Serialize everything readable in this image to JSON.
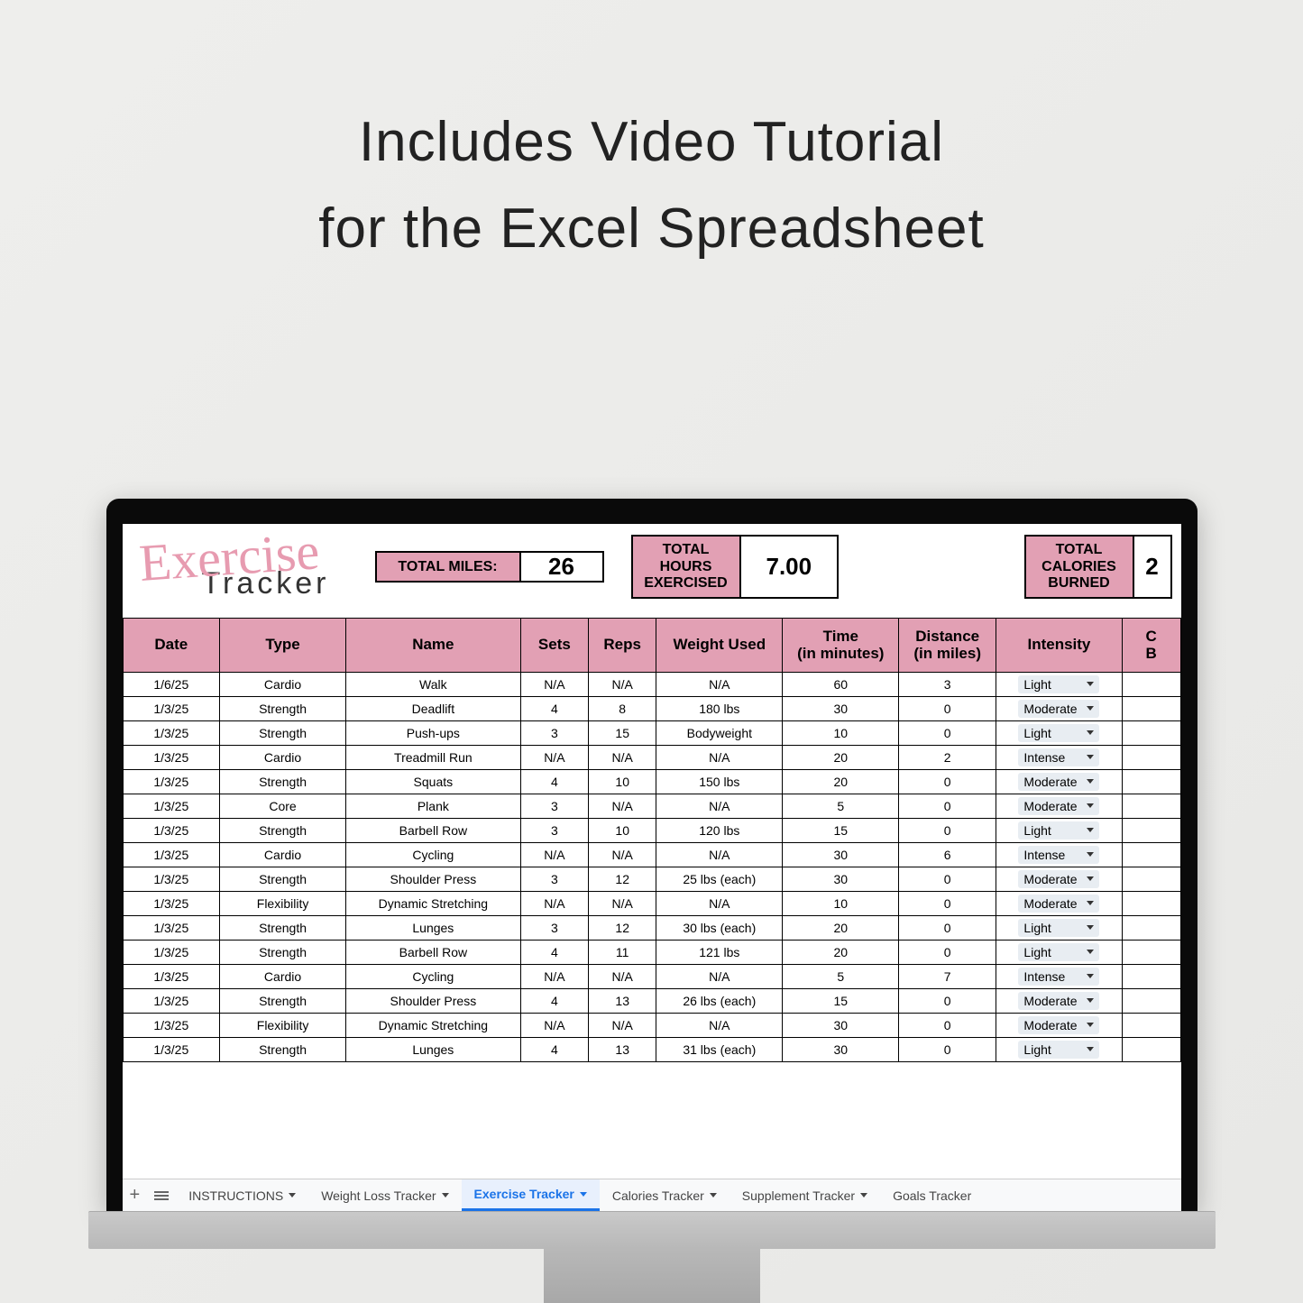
{
  "headline": {
    "line1": "Includes Video Tutorial",
    "line2": "for the Excel Spreadsheet"
  },
  "logo": {
    "script": "Exercise",
    "sub": "Tracker"
  },
  "summary": {
    "miles_label": "TOTAL MILES:",
    "miles_value": "26",
    "hours_label": "TOTAL\nHOURS\nEXERCISED",
    "hours_value": "7.00",
    "cals_label": "TOTAL\nCALORIES\nBURNED",
    "cals_value": "2"
  },
  "columns": {
    "date": "Date",
    "type": "Type",
    "name": "Name",
    "sets": "Sets",
    "reps": "Reps",
    "weight": "Weight Used",
    "time": "Time\n(in minutes)",
    "dist": "Distance\n(in miles)",
    "intensity": "Intensity",
    "cals": "C\nB"
  },
  "rows": [
    {
      "date": "1/6/25",
      "type": "Cardio",
      "name": "Walk",
      "sets": "N/A",
      "reps": "N/A",
      "weight": "N/A",
      "time": "60",
      "dist": "3",
      "intensity": "Light"
    },
    {
      "date": "1/3/25",
      "type": "Strength",
      "name": "Deadlift",
      "sets": "4",
      "reps": "8",
      "weight": "180 lbs",
      "time": "30",
      "dist": "0",
      "intensity": "Moderate"
    },
    {
      "date": "1/3/25",
      "type": "Strength",
      "name": "Push-ups",
      "sets": "3",
      "reps": "15",
      "weight": "Bodyweight",
      "time": "10",
      "dist": "0",
      "intensity": "Light"
    },
    {
      "date": "1/3/25",
      "type": "Cardio",
      "name": "Treadmill Run",
      "sets": "N/A",
      "reps": "N/A",
      "weight": "N/A",
      "time": "20",
      "dist": "2",
      "intensity": "Intense"
    },
    {
      "date": "1/3/25",
      "type": "Strength",
      "name": "Squats",
      "sets": "4",
      "reps": "10",
      "weight": "150 lbs",
      "time": "20",
      "dist": "0",
      "intensity": "Moderate"
    },
    {
      "date": "1/3/25",
      "type": "Core",
      "name": "Plank",
      "sets": "3",
      "reps": "N/A",
      "weight": "N/A",
      "time": "5",
      "dist": "0",
      "intensity": "Moderate"
    },
    {
      "date": "1/3/25",
      "type": "Strength",
      "name": "Barbell Row",
      "sets": "3",
      "reps": "10",
      "weight": "120 lbs",
      "time": "15",
      "dist": "0",
      "intensity": "Light"
    },
    {
      "date": "1/3/25",
      "type": "Cardio",
      "name": "Cycling",
      "sets": "N/A",
      "reps": "N/A",
      "weight": "N/A",
      "time": "30",
      "dist": "6",
      "intensity": "Intense"
    },
    {
      "date": "1/3/25",
      "type": "Strength",
      "name": "Shoulder Press",
      "sets": "3",
      "reps": "12",
      "weight": "25 lbs (each)",
      "time": "30",
      "dist": "0",
      "intensity": "Moderate"
    },
    {
      "date": "1/3/25",
      "type": "Flexibility",
      "name": "Dynamic Stretching",
      "sets": "N/A",
      "reps": "N/A",
      "weight": "N/A",
      "time": "10",
      "dist": "0",
      "intensity": "Moderate"
    },
    {
      "date": "1/3/25",
      "type": "Strength",
      "name": "Lunges",
      "sets": "3",
      "reps": "12",
      "weight": "30 lbs (each)",
      "time": "20",
      "dist": "0",
      "intensity": "Light"
    },
    {
      "date": "1/3/25",
      "type": "Strength",
      "name": "Barbell Row",
      "sets": "4",
      "reps": "11",
      "weight": "121 lbs",
      "time": "20",
      "dist": "0",
      "intensity": "Light"
    },
    {
      "date": "1/3/25",
      "type": "Cardio",
      "name": "Cycling",
      "sets": "N/A",
      "reps": "N/A",
      "weight": "N/A",
      "time": "5",
      "dist": "7",
      "intensity": "Intense"
    },
    {
      "date": "1/3/25",
      "type": "Strength",
      "name": "Shoulder Press",
      "sets": "4",
      "reps": "13",
      "weight": "26 lbs (each)",
      "time": "15",
      "dist": "0",
      "intensity": "Moderate"
    },
    {
      "date": "1/3/25",
      "type": "Flexibility",
      "name": "Dynamic Stretching",
      "sets": "N/A",
      "reps": "N/A",
      "weight": "N/A",
      "time": "30",
      "dist": "0",
      "intensity": "Moderate"
    },
    {
      "date": "1/3/25",
      "type": "Strength",
      "name": "Lunges",
      "sets": "4",
      "reps": "13",
      "weight": "31 lbs (each)",
      "time": "30",
      "dist": "0",
      "intensity": "Light"
    }
  ],
  "tabs": {
    "instructions": "INSTRUCTIONS",
    "weight": "Weight Loss Tracker",
    "exercise": "Exercise Tracker",
    "calories": "Calories Tracker",
    "supplement": "Supplement Tracker",
    "goals": "Goals Tracker"
  }
}
